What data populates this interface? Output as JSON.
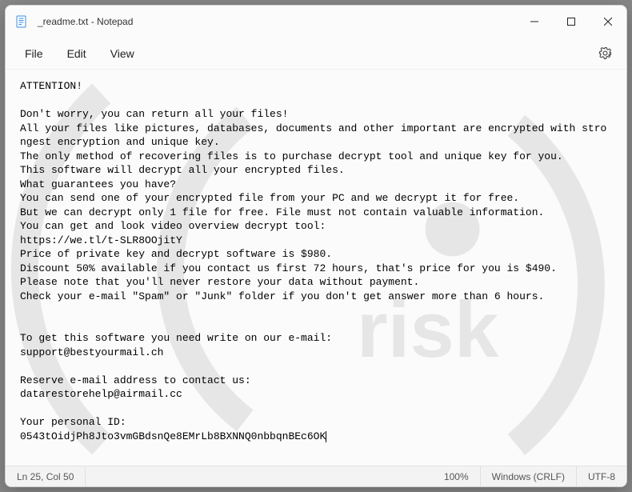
{
  "titlebar": {
    "title": "_readme.txt - Notepad"
  },
  "menubar": {
    "file": "File",
    "edit": "Edit",
    "view": "View"
  },
  "body": {
    "text": "ATTENTION!\n\nDon't worry, you can return all your files!\nAll your files like pictures, databases, documents and other important are encrypted with strongest encryption and unique key.\nThe only method of recovering files is to purchase decrypt tool and unique key for you.\nThis software will decrypt all your encrypted files.\nWhat guarantees you have?\nYou can send one of your encrypted file from your PC and we decrypt it for free.\nBut we can decrypt only 1 file for free. File must not contain valuable information.\nYou can get and look video overview decrypt tool:\nhttps://we.tl/t-SLR8OOjitY\nPrice of private key and decrypt software is $980.\nDiscount 50% available if you contact us first 72 hours, that's price for you is $490.\nPlease note that you'll never restore your data without payment.\nCheck your e-mail \"Spam\" or \"Junk\" folder if you don't get answer more than 6 hours.\n\n\nTo get this software you need write on our e-mail:\nsupport@bestyourmail.ch\n\nReserve e-mail address to contact us:\ndatarestorehelp@airmail.cc\n\nYour personal ID:\n0543tOidjPh8Jto3vmGBdsnQe8EMrLb8BXNNQ0nbbqnBEc6OK"
  },
  "statusbar": {
    "pos": "Ln 25, Col 50",
    "zoom": "100%",
    "eol": "Windows (CRLF)",
    "enc": "UTF-8"
  }
}
